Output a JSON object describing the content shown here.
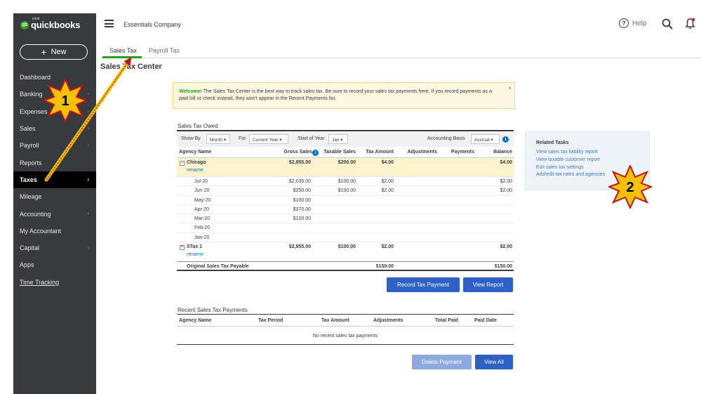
{
  "app": {
    "logo_prefix": "intuit",
    "logo_name": "quickbooks",
    "logo_badge": "qb",
    "company": "Essentials Company"
  },
  "header": {
    "help_label": "Help"
  },
  "sidebar": {
    "new_label": "New",
    "items": [
      {
        "label": "Dashboard",
        "chevron": false
      },
      {
        "label": "Banking",
        "chevron": true
      },
      {
        "label": "Expenses",
        "chevron": true
      },
      {
        "label": "Sales",
        "chevron": true
      },
      {
        "label": "Payroll",
        "chevron": true
      },
      {
        "label": "Reports",
        "chevron": false
      },
      {
        "label": "Taxes",
        "chevron": true,
        "active": true
      },
      {
        "label": "Mileage",
        "chevron": false
      },
      {
        "label": "Accounting",
        "chevron": true
      },
      {
        "label": "My Accountant",
        "chevron": false
      },
      {
        "label": "Capital",
        "chevron": true
      },
      {
        "label": "Apps",
        "chevron": false
      },
      {
        "label": "Time Tracking",
        "chevron": false
      }
    ]
  },
  "tabs": [
    {
      "label": "Sales Tax",
      "active": true
    },
    {
      "label": "Payroll Tax",
      "active": false
    }
  ],
  "page_title": "Sales Tax Center",
  "banner": {
    "bold": "Welcome!",
    "text": " The Sales Tax Center is the best way to track sales tax. Be sure to record your sales tax payments here. If you record payments as a paid bill or check instead, they won't appear in the Recent Payments list.",
    "close": "×"
  },
  "owed": {
    "title": "Sales Tax Owed",
    "filters": {
      "show_by_label": "Show By",
      "show_by_value": "Month",
      "for_label": "For",
      "for_value": "Current Year",
      "start_label": "Start of Year",
      "start_value": "Jan",
      "basis_label": "Accounting Basis",
      "basis_value": "Accrual"
    },
    "columns": [
      "Agency Name",
      "Gross Sales",
      "Taxable Sales",
      "Tax Amount",
      "Adjustments",
      "Payments",
      "Balance"
    ],
    "agencies": [
      {
        "name": "Chicago",
        "rename": "rename",
        "toggle": "−",
        "gross": "$2,855.00",
        "taxable": "$200.00",
        "tax": "$4.00",
        "balance": "$4.00",
        "months": [
          {
            "month": "Jul-20",
            "gross": "$2,035.00",
            "taxable": "$100.00",
            "tax": "$2.00",
            "balance": "$2.00"
          },
          {
            "month": "Jun-20",
            "gross": "$250.00",
            "taxable": "$100.00",
            "tax": "$2.00",
            "balance": "$2.00"
          },
          {
            "month": "May-20",
            "gross": "$100.00",
            "taxable": "",
            "tax": "",
            "balance": ""
          },
          {
            "month": "Apr-20",
            "gross": "$370.00",
            "taxable": "",
            "tax": "",
            "balance": ""
          },
          {
            "month": "Mar-20",
            "gross": "$100.00",
            "taxable": "",
            "tax": "",
            "balance": ""
          },
          {
            "month": "Feb-20",
            "gross": "",
            "taxable": "",
            "tax": "",
            "balance": ""
          },
          {
            "month": "Jan-20",
            "gross": "",
            "taxable": "",
            "tax": "",
            "balance": ""
          }
        ]
      },
      {
        "name": "STax 1",
        "rename": "rename",
        "toggle": "+",
        "gross": "$2,855.00",
        "taxable": "$100.00",
        "tax": "$2.00",
        "balance": "$2.00",
        "months": []
      }
    ],
    "total": {
      "label": "Original Sales Tax Payable",
      "tax": "$150.00",
      "balance": "$150.00"
    },
    "record_button": "Record Tax Payment",
    "view_report_button": "View Report"
  },
  "recent": {
    "title": "Recent Sales Tax Payments",
    "columns": [
      "Agency Name",
      "Tax Period",
      "Tax Amount",
      "Adjustments",
      "Total Paid",
      "Paid Date"
    ],
    "empty": "No recent sales tax payments",
    "delete_button": "Delete Payment",
    "view_all_button": "View All"
  },
  "related": {
    "title": "Related Tasks",
    "links": [
      "View sales tax liability report",
      "View taxable customer report",
      "Edit sales tax settings",
      "Add/edit tax rates and agencies"
    ]
  },
  "callouts": [
    {
      "label": "1"
    },
    {
      "label": "2"
    }
  ],
  "colors": {
    "sidebar": "#393a3d",
    "accent_green": "#2ca01c",
    "button_blue": "#2d62c4",
    "link_blue": "#0077c5",
    "callout_gold": "#f5c000",
    "callout_red": "#c2160a"
  }
}
